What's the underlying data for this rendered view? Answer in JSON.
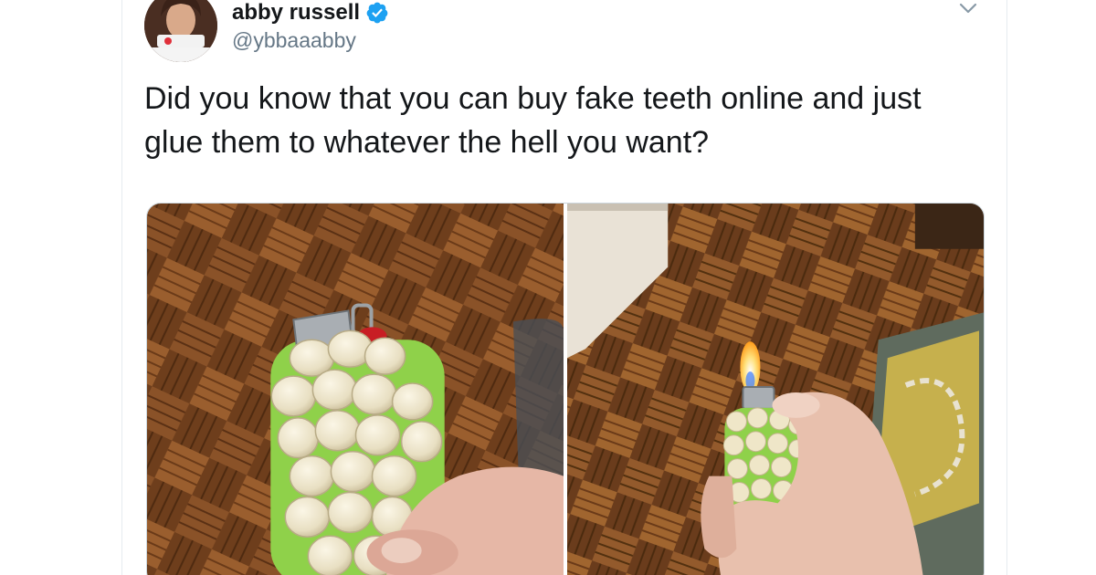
{
  "tweet": {
    "author_name": "abby russell",
    "author_handle": "@ybbaaabby",
    "verified": true,
    "text": "Did you know that you can buy fake teeth online and just glue them to whatever the hell you want?",
    "media_count": 2
  },
  "icons": {
    "verified": "verified-badge-icon",
    "menu": "chevron-down-icon"
  },
  "colors": {
    "verified_blue": "#1da1f2",
    "handle_gray": "#657786",
    "text_dark": "#14171a"
  }
}
